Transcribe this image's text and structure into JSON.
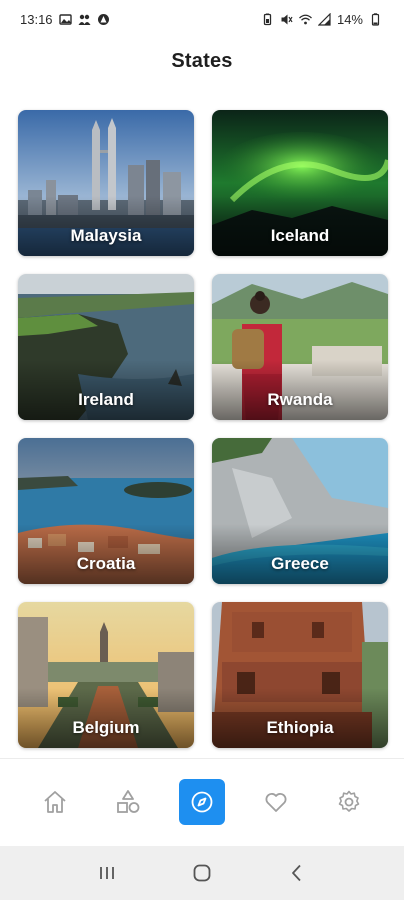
{
  "status_bar": {
    "time": "13:16",
    "battery": "14%"
  },
  "header": {
    "title": "States"
  },
  "cards": [
    {
      "label": "Malaysia"
    },
    {
      "label": "Iceland"
    },
    {
      "label": "Ireland"
    },
    {
      "label": "Rwanda"
    },
    {
      "label": "Croatia"
    },
    {
      "label": "Greece"
    },
    {
      "label": "Belgium"
    },
    {
      "label": "Ethiopia"
    }
  ],
  "bottom_nav": {
    "items": [
      {
        "icon": "home-icon",
        "active": false
      },
      {
        "icon": "shapes-icon",
        "active": false
      },
      {
        "icon": "compass-icon",
        "active": true
      },
      {
        "icon": "heart-icon",
        "active": false
      },
      {
        "icon": "gear-icon",
        "active": false
      }
    ],
    "active_color": "#1e8ff0"
  },
  "system_nav": {
    "items": [
      "recents-icon",
      "home-circle-icon",
      "back-icon"
    ]
  }
}
